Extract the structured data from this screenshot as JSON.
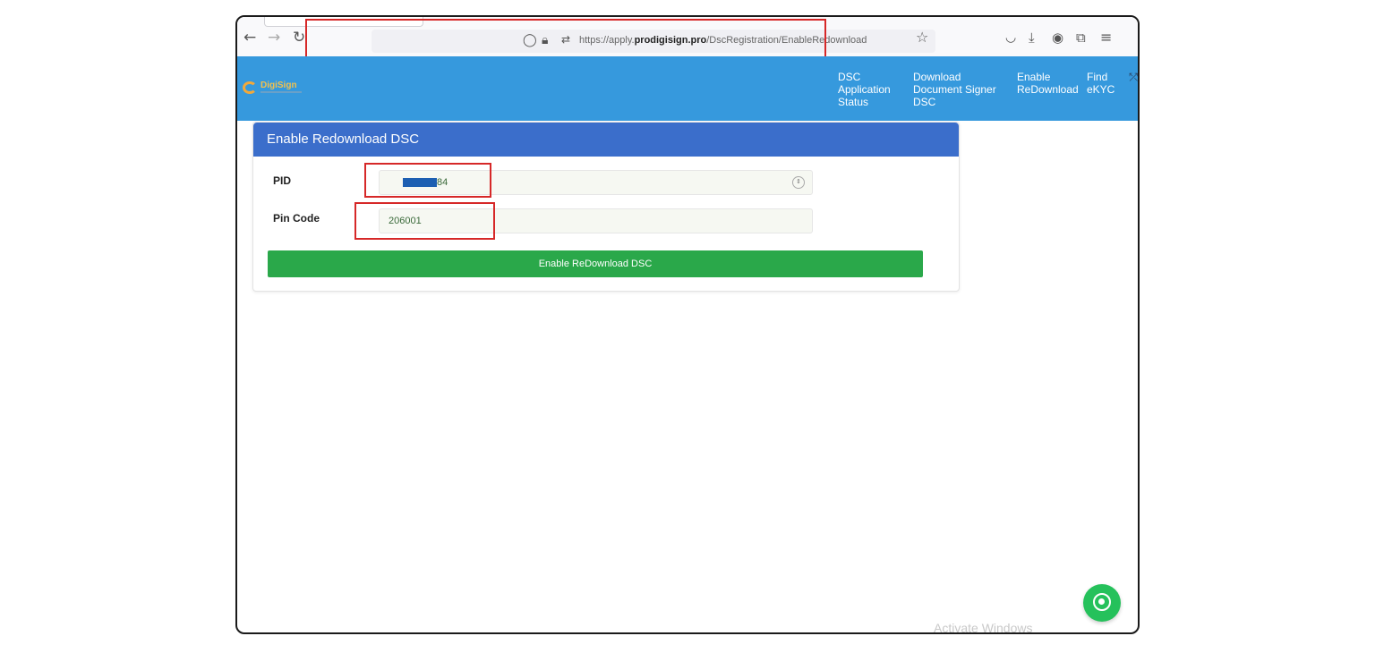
{
  "browser": {
    "url_prefix": "https://apply.",
    "url_domain": "prodigisign.pro",
    "url_path": "/DscRegistration/EnableRedownload",
    "icons": [
      "back-icon",
      "forward-icon",
      "reload-icon",
      "shield-icon",
      "lock-icon",
      "permissions-icon",
      "bookmark-star-icon",
      "pocket-icon",
      "download-icon",
      "account-icon",
      "extensions-icon",
      "menu-icon"
    ]
  },
  "header": {
    "logo_text": "DigiSign",
    "nav": [
      {
        "lines": [
          "DSC",
          "Application",
          "Status"
        ]
      },
      {
        "lines": [
          "Download",
          "Document Signer",
          "DSC"
        ]
      },
      {
        "lines": [
          "Enable",
          "ReDownload"
        ]
      },
      {
        "lines": [
          "Find",
          "eKYC"
        ]
      }
    ]
  },
  "card": {
    "title": "Enable Redownload DSC",
    "pid_label": "PID",
    "pid_value": "84",
    "pincode_label": "Pin Code",
    "pincode_value": "206001",
    "submit_label": "Enable ReDownload DSC"
  },
  "watermark": "Activate Windows",
  "colors": {
    "navbar": "#3699dd",
    "card_header": "#3b6ecb",
    "submit": "#2aa84a",
    "highlight": "#d62828",
    "whatsapp": "#25c15b"
  }
}
